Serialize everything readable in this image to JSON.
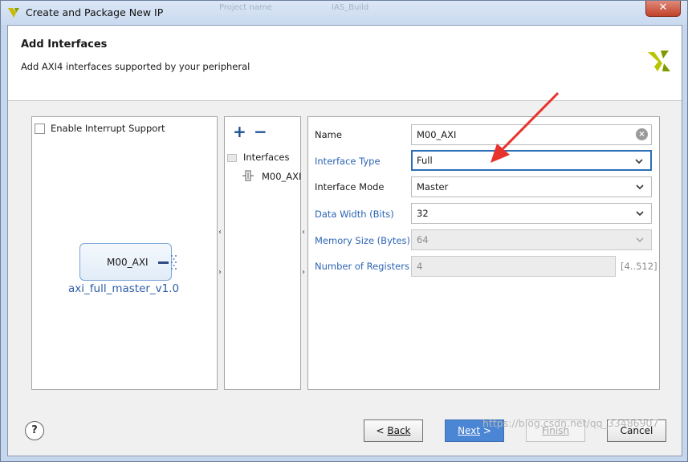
{
  "window": {
    "title": "Create and Package New IP",
    "ghost_tabs": [
      "Project name",
      "IAS_Build"
    ],
    "close_label": "✕"
  },
  "header": {
    "title": "Add Interfaces",
    "subtitle": "Add AXI4 interfaces supported by your peripheral"
  },
  "left_panel": {
    "interrupt_label": "Enable Interrupt Support",
    "interrupt_checked": false,
    "ip_port": "M00_AXI",
    "ip_name": "axi_full_master_v1.0"
  },
  "interfaces_panel": {
    "add_label": "+",
    "remove_label": "−",
    "folder_label": "Interfaces",
    "items": [
      "M00_AXI"
    ]
  },
  "form": {
    "name_label": "Name",
    "name_value": "M00_AXI",
    "type_label": "Interface Type",
    "type_value": "Full",
    "mode_label": "Interface Mode",
    "mode_value": "Master",
    "width_label": "Data Width (Bits)",
    "width_value": "32",
    "memsize_label": "Memory Size (Bytes)",
    "memsize_value": "64",
    "regs_label": "Number of Registers",
    "regs_value": "4",
    "regs_range": "[4..512]"
  },
  "footer": {
    "help_label": "?",
    "back_prefix": "< ",
    "back_label": "Back",
    "next_label": "Next",
    "next_suffix": " >",
    "finish_label": "Finish",
    "cancel_label": "Cancel"
  },
  "watermark": "https://blog.csdn.net/qq_33486907",
  "colors": {
    "accent": "#2f6fb8",
    "primary_button": "#4a86d4",
    "link_label": "#2d64b3",
    "annotation_arrow": "#e8322d"
  }
}
